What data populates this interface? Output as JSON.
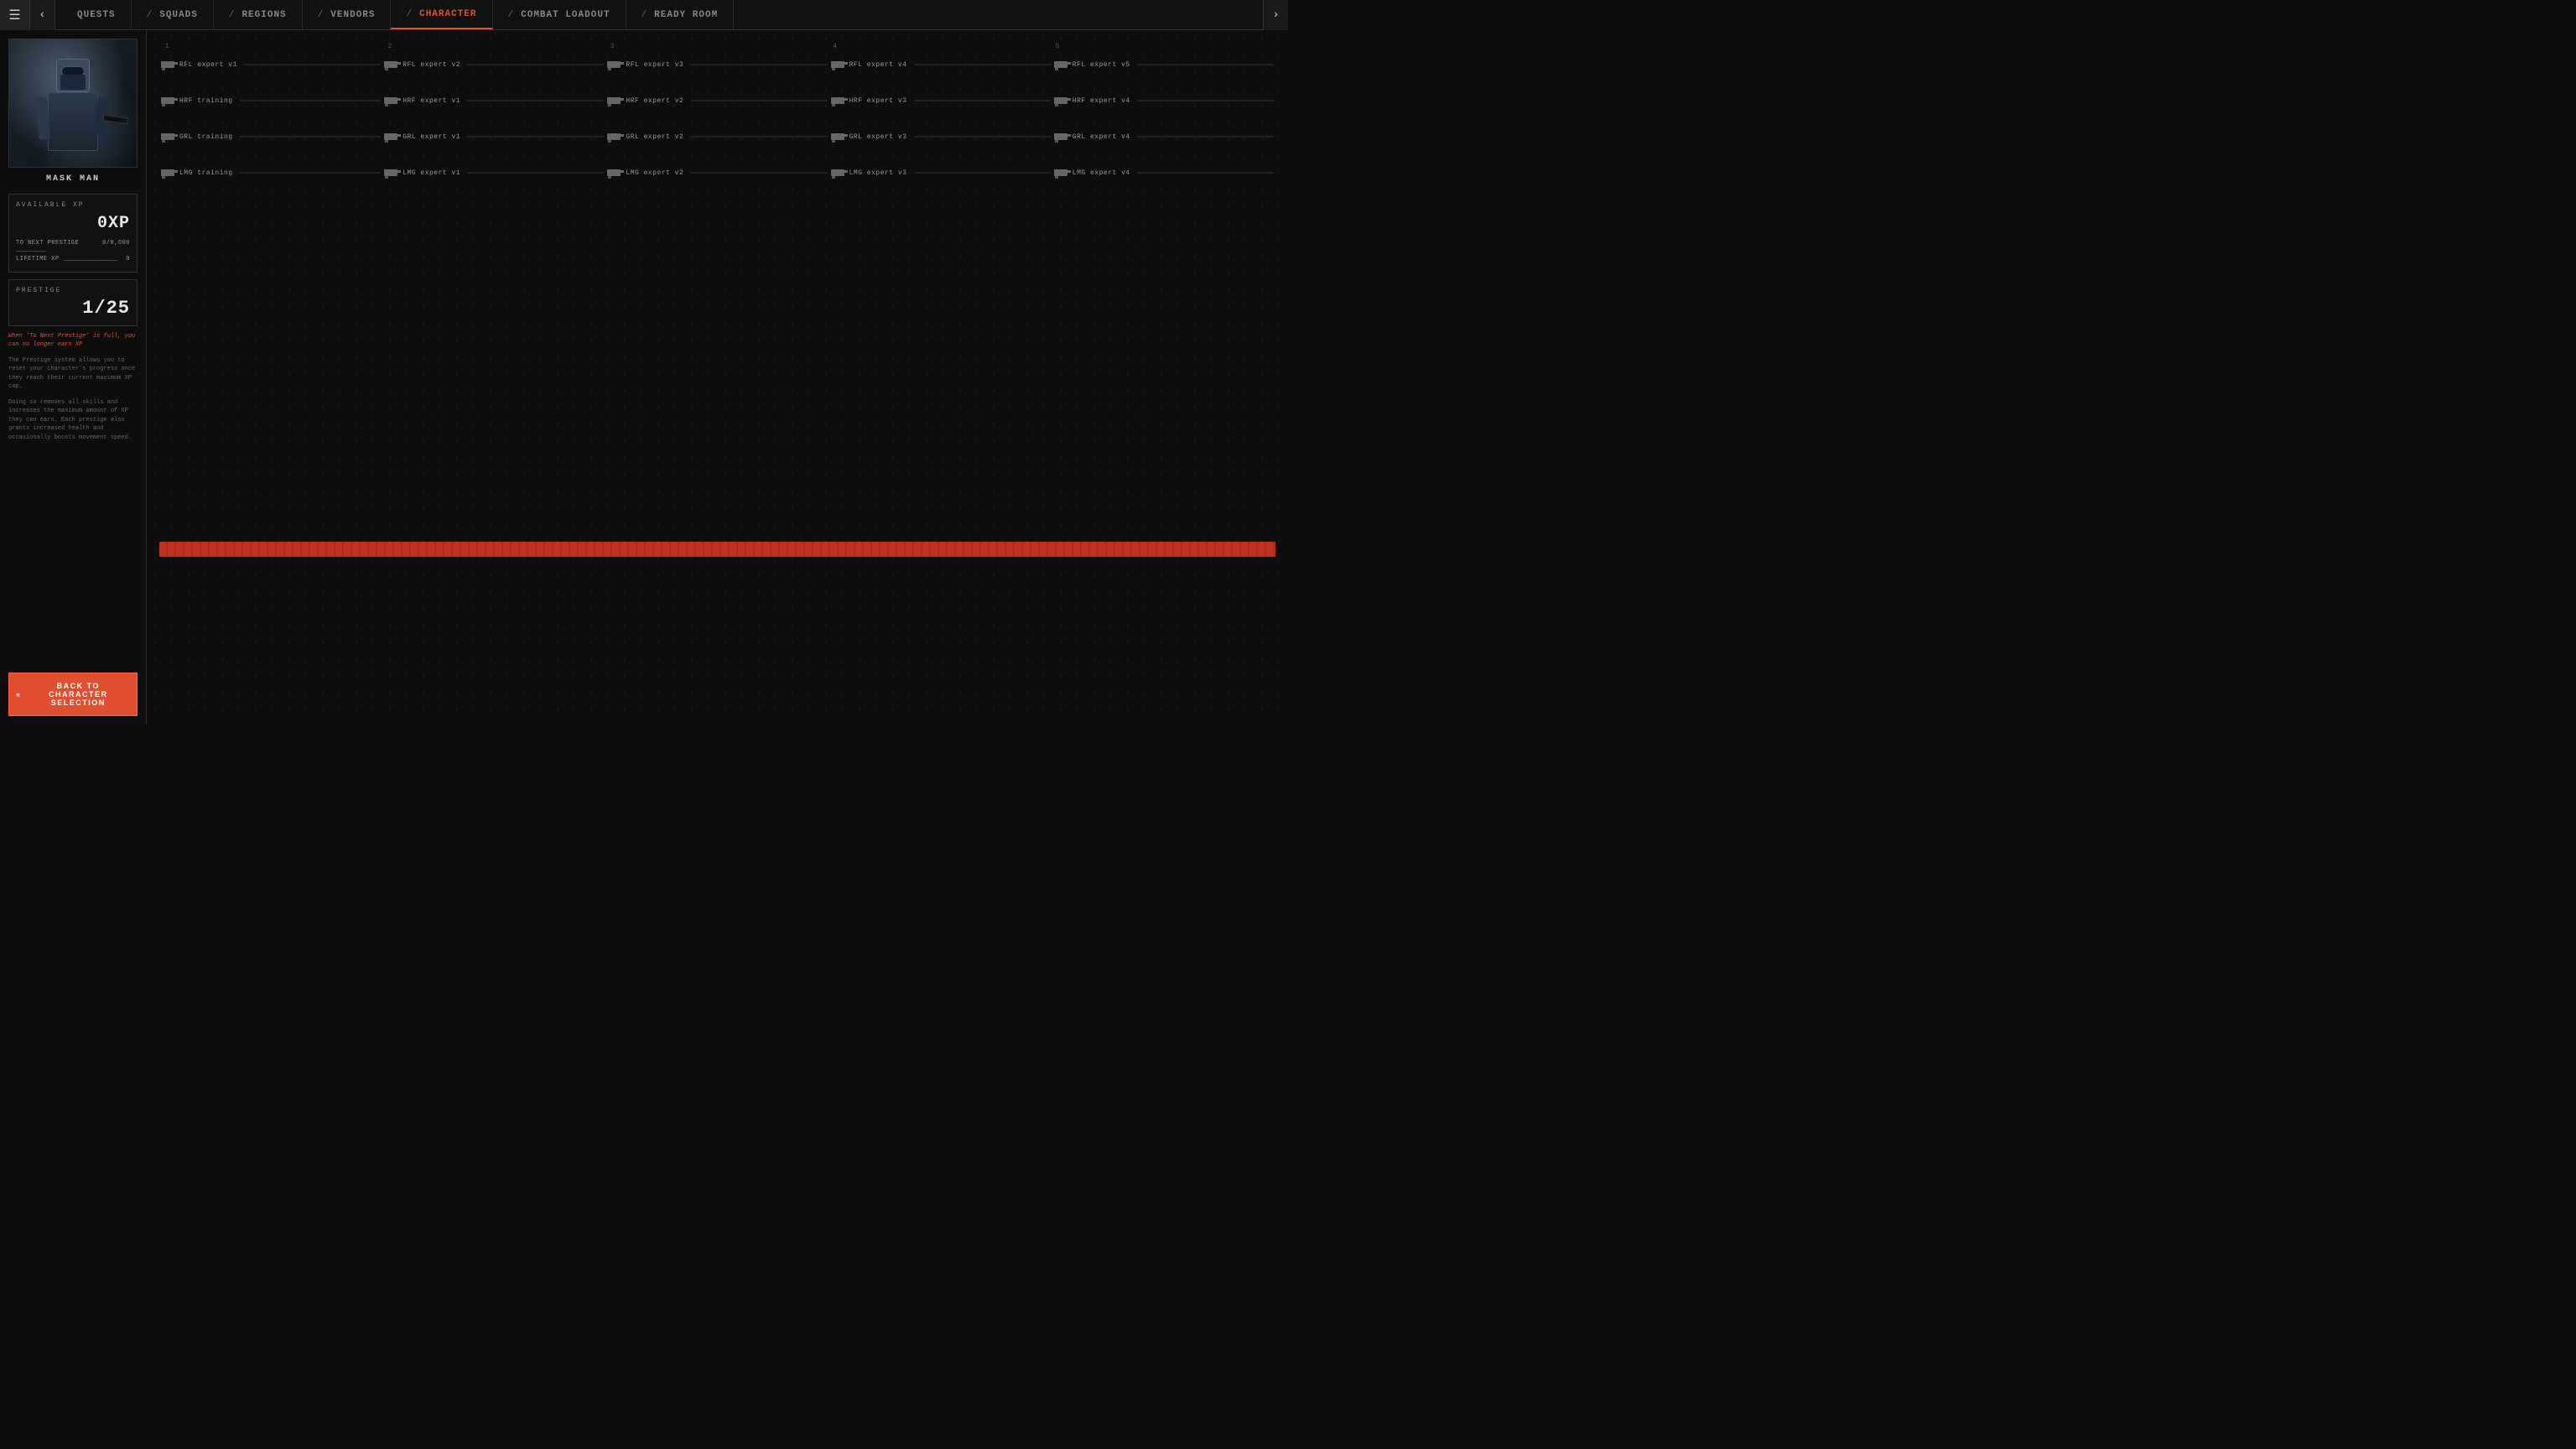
{
  "nav": {
    "tabs": [
      {
        "label": "QUESTS",
        "slash": "",
        "active": false
      },
      {
        "label": "SQUADS",
        "slash": "/",
        "active": false
      },
      {
        "label": "REGIONS",
        "slash": "/",
        "active": false
      },
      {
        "label": "VENDORS",
        "slash": "/",
        "active": false
      },
      {
        "label": "CHARACTER",
        "slash": "/",
        "active": true
      },
      {
        "label": "COMBAT LOADOUT",
        "slash": "/",
        "active": false
      },
      {
        "label": "READY ROOM",
        "slash": "/",
        "active": false
      }
    ]
  },
  "character": {
    "name": "MASK MAN"
  },
  "xp": {
    "section_label": "AVAILABLE XP",
    "value": "0XP",
    "to_next_label": "TO NEXT PRESTIGE",
    "to_next_dots": "___________",
    "to_next_value": "0/8,000",
    "lifetime_label": "LIFETIME XP",
    "lifetime_dots": "____________________",
    "lifetime_value": "0"
  },
  "prestige": {
    "label": "PRESTIGE",
    "value": "1/25",
    "warning": "When 'To Next Prestige' is full, you can no longer earn XP",
    "desc1": "The Prestige system allows you to reset your character's progress once they reach their current maximum XP cap.",
    "desc2": "Doing so removes all skills and increases the maximum amount of XP they can earn. Each prestige also grants increased health and occasionally boosts movement speed."
  },
  "back_button": {
    "label": "BACK TO CHARACTER SELECTION",
    "arrow": "«"
  },
  "column_numbers": [
    "1",
    "2",
    "3",
    "4",
    "5"
  ],
  "skill_rows": [
    {
      "id": "rfl",
      "skills": [
        {
          "name": "RFL expert v1",
          "type": "rfl"
        },
        {
          "name": "RFL expert v2",
          "type": "rfl"
        },
        {
          "name": "RFL expert v3",
          "type": "rfl"
        },
        {
          "name": "RFL expert v4",
          "type": "rfl"
        },
        {
          "name": "RFL expert v5",
          "type": "rfl"
        }
      ]
    },
    {
      "id": "hrf",
      "skills": [
        {
          "name": "HRF training",
          "type": "hrf"
        },
        {
          "name": "HRF expert v1",
          "type": "hrf"
        },
        {
          "name": "HRF expert v2",
          "type": "hrf"
        },
        {
          "name": "HRF expert v3",
          "type": "hrf"
        },
        {
          "name": "HRF expert v4",
          "type": "hrf"
        }
      ]
    },
    {
      "id": "grl",
      "skills": [
        {
          "name": "GRL training",
          "type": "grl"
        },
        {
          "name": "GRL expert v1",
          "type": "grl"
        },
        {
          "name": "GRL expert v2",
          "type": "grl"
        },
        {
          "name": "GRL expert v3",
          "type": "grl"
        },
        {
          "name": "GRL expert v4",
          "type": "grl"
        }
      ]
    },
    {
      "id": "lmg",
      "skills": [
        {
          "name": "LMG training",
          "type": "lmg"
        },
        {
          "name": "LMG expert v1",
          "type": "lmg"
        },
        {
          "name": "LMG expert v2",
          "type": "lmg"
        },
        {
          "name": "LMG expert v3",
          "type": "lmg"
        },
        {
          "name": "LMG expert v4",
          "type": "lmg"
        }
      ]
    }
  ]
}
